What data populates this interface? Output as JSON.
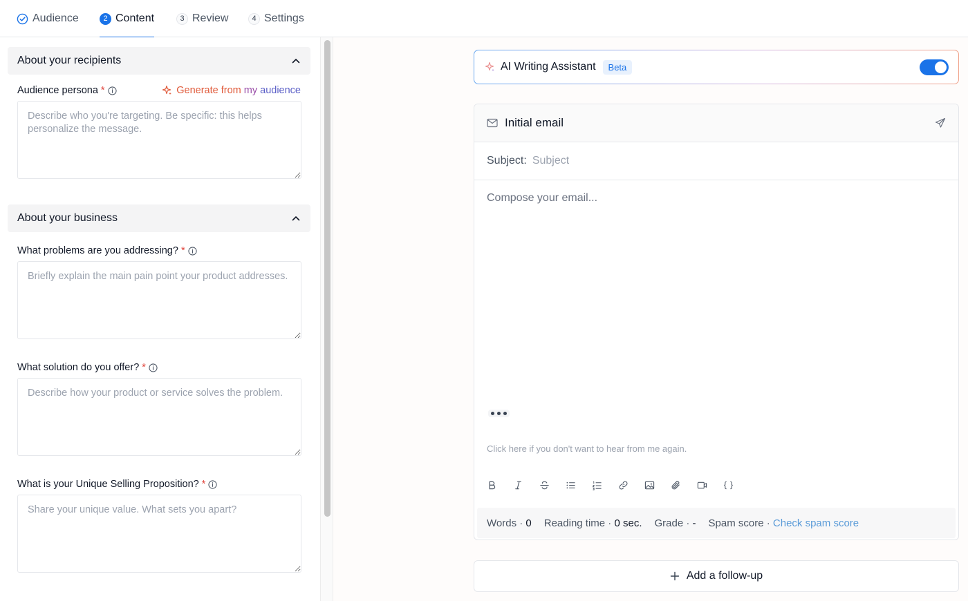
{
  "steps": [
    {
      "num": "",
      "label": "Audience"
    },
    {
      "num": "2",
      "label": "Content"
    },
    {
      "num": "3",
      "label": "Review"
    },
    {
      "num": "4",
      "label": "Settings"
    }
  ],
  "left": {
    "recipients": {
      "title": "About your recipients",
      "persona_label": "Audience persona",
      "generate_parts": [
        "Generate from",
        "my",
        "audience"
      ],
      "persona_placeholder": "Describe who you're targeting. Be specific: this helps personalize the message."
    },
    "business": {
      "title": "About your business",
      "problems_label": "What problems are you addressing?",
      "problems_placeholder": "Briefly explain the main pain point your product addresses.",
      "solution_label": "What solution do you offer?",
      "solution_placeholder": "Describe how your product or service solves the problem.",
      "usp_label": "What is your Unique Selling Proposition?",
      "usp_placeholder": "Share your unique value. What sets you apart?"
    },
    "required_mark": "*"
  },
  "ai_assistant": {
    "title": "AI Writing Assistant",
    "badge": "Beta",
    "enabled": true
  },
  "email": {
    "title": "Initial email",
    "subject_label": "Subject:",
    "subject_placeholder": "Subject",
    "subject_value": "",
    "compose_placeholder": "Compose your email...",
    "unsubscribe_text": "Click here if you don't want to hear from me again.",
    "toolbar_icons": [
      "bold-icon",
      "italic-icon",
      "strikethrough-icon",
      "bullet-list-icon",
      "numbered-list-icon",
      "link-icon",
      "image-icon",
      "attachment-icon",
      "video-icon",
      "variables-icon"
    ],
    "stats": {
      "words_label": "Words ·",
      "words_value": "0",
      "reading_label": "Reading time ·",
      "reading_value": "0 sec.",
      "grade_label": "Grade ·",
      "grade_value": "-",
      "spam_label": "Spam score ·",
      "spam_link": "Check spam score"
    }
  },
  "followup": {
    "label": "Add a follow-up"
  },
  "colors": {
    "accent": "#1a73e8",
    "required": "#e0433a",
    "generate_start": "#e05a3a",
    "generate_end": "#5b5fc7",
    "link": "#5a9bd8"
  }
}
